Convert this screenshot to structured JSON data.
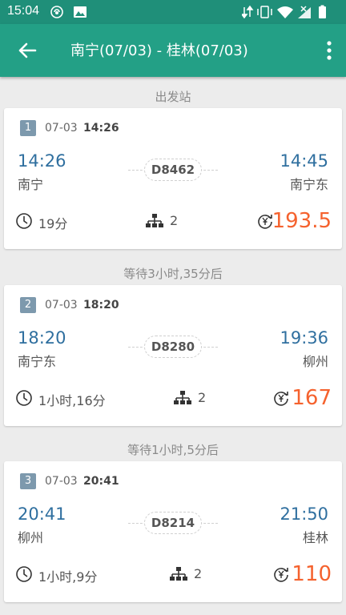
{
  "status_bar": {
    "time": "15:04",
    "left_icons": [
      "wifi-hotspot-icon",
      "image-icon"
    ],
    "right_icons": [
      "data-arrows-icon",
      "vibrate-icon",
      "wifi-icon",
      "no-signal-icon",
      "battery-icon"
    ]
  },
  "app_bar": {
    "title": "南宁(07/03) - 桂林(07/03)",
    "back_icon": "arrow-left-icon",
    "more_icon": "more-vert-icon",
    "color": "#23a086"
  },
  "sections": [
    {
      "label": "出发站"
    },
    {
      "label": "等待3小时,35分后"
    },
    {
      "label": "等待1小时,5分后"
    }
  ],
  "legs": [
    {
      "index": "1",
      "date": "07-03",
      "time": "14:26",
      "dep_time": "14:26",
      "dep_station": "南宁",
      "train": "D8462",
      "arr_time": "14:45",
      "arr_station": "南宁东",
      "duration": "19分",
      "changes": "2",
      "price": "193.5"
    },
    {
      "index": "2",
      "date": "07-03",
      "time": "18:20",
      "dep_time": "18:20",
      "dep_station": "南宁东",
      "train": "D8280",
      "arr_time": "19:36",
      "arr_station": "柳州",
      "duration": "1小时,16分",
      "changes": "2",
      "price": "167"
    },
    {
      "index": "3",
      "date": "07-03",
      "time": "20:41",
      "dep_time": "20:41",
      "dep_station": "柳州",
      "train": "D8214",
      "arr_time": "21:50",
      "arr_station": "桂林",
      "duration": "1小时,9分",
      "changes": "2",
      "price": "110"
    }
  ],
  "colors": {
    "accent": "#23a086",
    "time_blue": "#2f6f9f",
    "price_orange": "#f5622e",
    "index_badge": "#7d99ad"
  }
}
